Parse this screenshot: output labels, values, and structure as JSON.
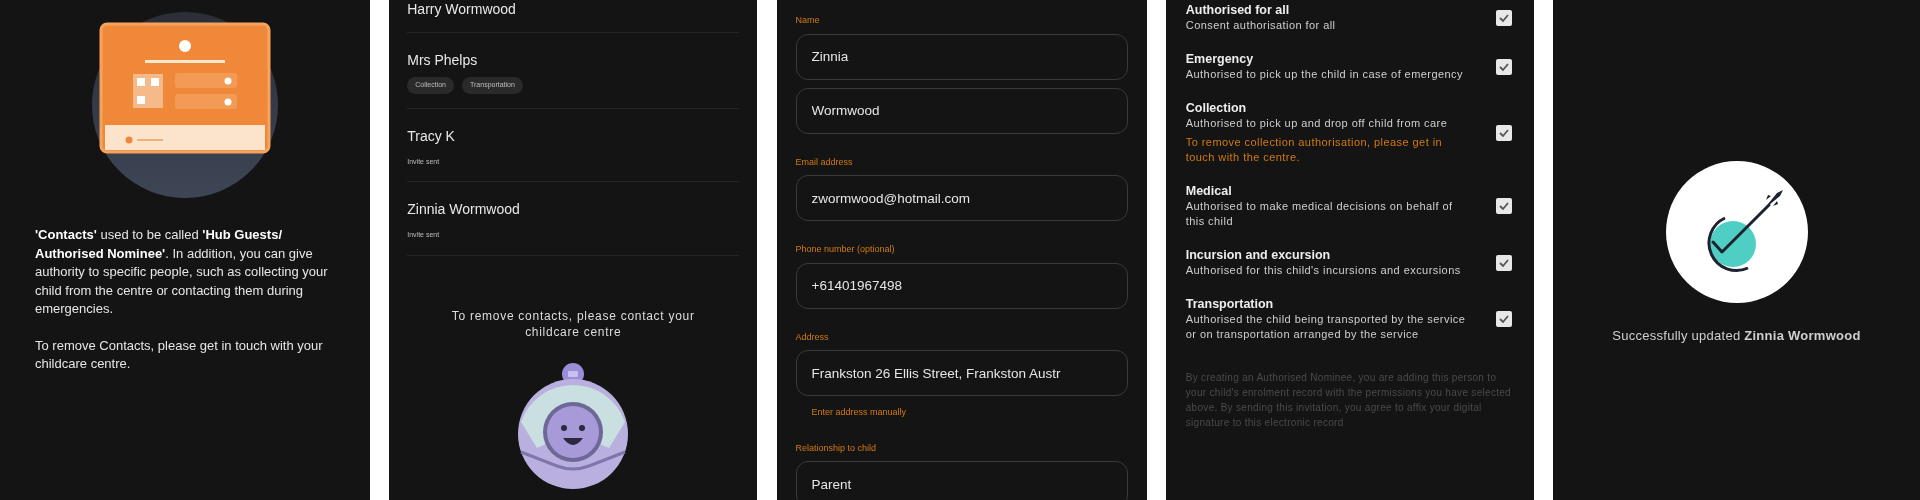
{
  "intro": {
    "paragraphs": [
      "**'Contacts'** used to be called **'Hub Guests/ Authorised Nominee'**. In addition, you can give authority to specific people, such as collecting your child from the centre or contacting them during emergencies.",
      "To remove Contacts, please get in touch with your childcare centre."
    ]
  },
  "contacts": {
    "items": [
      {
        "name": "Harry Wormwood"
      },
      {
        "name": "Mrs Phelps",
        "tags": [
          "Collection",
          "Transportation"
        ]
      },
      {
        "name": "Tracy K",
        "status": "Invite sent"
      },
      {
        "name": "Zinnia Wormwood",
        "status": "Invite sent"
      }
    ],
    "notice": "To remove contacts, please contact your childcare centre"
  },
  "form": {
    "fields": [
      {
        "label": "Name",
        "values": [
          "Zinnia",
          "Wormwood"
        ]
      },
      {
        "label": "Email address",
        "values": [
          "zwormwood@hotmail.com"
        ]
      },
      {
        "label": "Phone number (optional)",
        "values": [
          "+61401967498"
        ]
      },
      {
        "label": "Address",
        "values": [
          "Frankston 26 Ellis Street, Frankston Austr"
        ],
        "link": "Enter address manually"
      },
      {
        "label": "Relationship to child",
        "values": [
          "Parent"
        ]
      }
    ]
  },
  "permissions": {
    "items": [
      {
        "title": "Authorised for all",
        "description": "Consent authorisation for all",
        "checked": true
      },
      {
        "title": "Emergency",
        "description": "Authorised to pick up the child in case of emergency",
        "checked": true
      },
      {
        "title": "Collection",
        "description": "Authorised to pick up and drop off child from care",
        "note": "To remove collection authorisation, please get in touch with the centre.",
        "checked": true
      },
      {
        "title": "Medical",
        "description": "Authorised to make medical decisions on behalf of this child",
        "checked": true
      },
      {
        "title": "Incursion and excursion",
        "description": "Authorised for this child's incursions and excursions",
        "checked": true
      },
      {
        "title": "Transportation",
        "description": "Authorised the child being transported by the service or on transportation arranged by the service",
        "checked": true
      }
    ],
    "disclaimer": "By creating an Authorised Nominee, you are adding this person to your child's enrolment record with the permissions you have selected above. By sending this invitation, you agree to affix your digital signature to this electronic record"
  },
  "success": {
    "message": "Successfully updated **Zinnia Wormwood**"
  }
}
